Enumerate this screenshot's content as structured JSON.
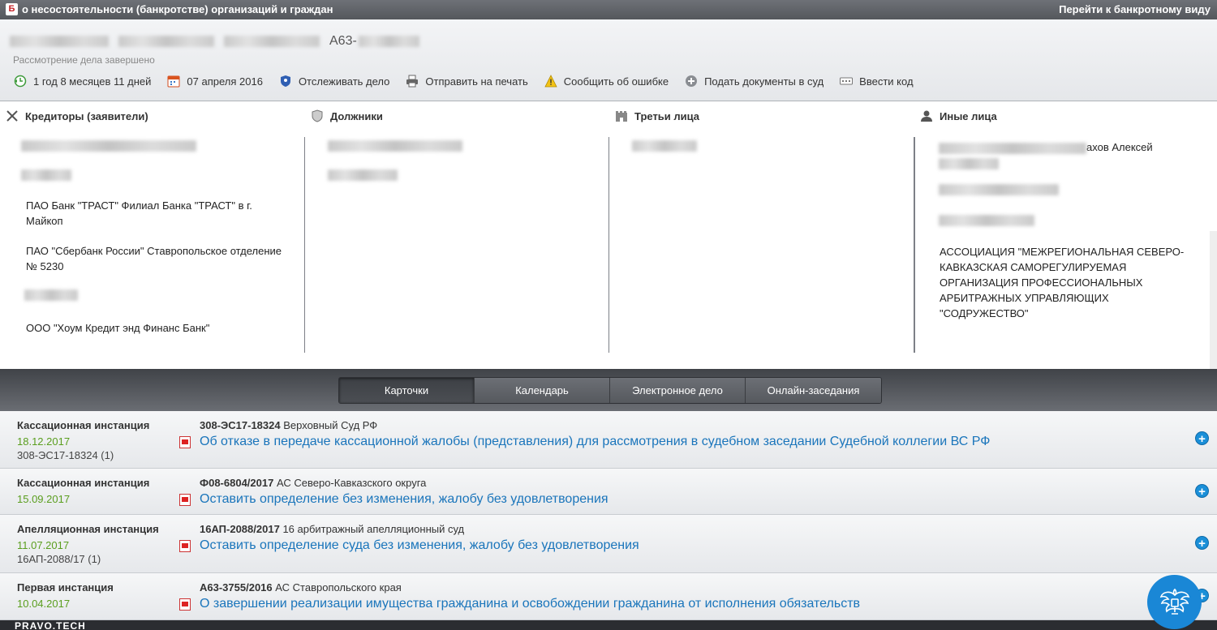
{
  "topbar": {
    "logo": "Б",
    "title": "о несостоятельности (банкротстве) организаций и граждан",
    "switch_view": "Перейти к банкротному виду"
  },
  "case": {
    "number_prefix": "А63-",
    "status": "Рассмотрение дела завершено",
    "actions": [
      {
        "label": "1 год 8 месяцев 11 дней",
        "icon": "duration-icon"
      },
      {
        "label": "07 апреля 2016",
        "icon": "calendar-icon"
      },
      {
        "label": "Отслеживать дело",
        "icon": "shield-icon"
      },
      {
        "label": "Отправить на печать",
        "icon": "printer-icon"
      },
      {
        "label": "Сообщить об ошибке",
        "icon": "warning-icon"
      },
      {
        "label": "Подать документы в суд",
        "icon": "plus-circle-icon"
      },
      {
        "label": "Ввести код",
        "icon": "keyboard-icon"
      }
    ]
  },
  "parties": {
    "creditors": {
      "heading": "Кредиторы (заявители)",
      "entries": [
        "ПАО Банк \"ТРАСТ\" Филиал Банка \"ТРАСТ\" в г. Майкоп",
        "ПАО \"Сбербанк России\" Ставропольское отделение № 5230",
        "ООО \"Хоум Кредит энд Финанс Банк\""
      ]
    },
    "debtors": {
      "heading": "Должники"
    },
    "third": {
      "heading": "Третьи лица"
    },
    "others": {
      "heading": "Иные лица",
      "first_suffix": "ахов Алексей",
      "association": "АССОЦИАЦИЯ \"МЕЖРЕГИОНАЛЬНАЯ СЕВЕРО-КАВКАЗСКАЯ САМОРЕГУЛИРУЕМАЯ ОРГАНИЗАЦИЯ ПРОФЕССИОНАЛЬНЫХ АРБИТРАЖНЫХ УПРАВЛЯЮЩИХ \"СОДРУЖЕСТВО\""
    }
  },
  "tabs": [
    "Карточки",
    "Календарь",
    "Электронное дело",
    "Онлайн-заседания"
  ],
  "instances": [
    {
      "instance": "Кассационная инстанция",
      "date": "18.12.2017",
      "sub": "308-ЭС17-18324 (1)",
      "case_no": "308-ЭС17-18324",
      "court": "Верховный Суд РФ",
      "document": "Об отказе в передаче кассационной жалобы (представления) для рассмотрения в судебном заседании Судебной коллегии ВС РФ"
    },
    {
      "instance": "Кассационная инстанция",
      "date": "15.09.2017",
      "sub": "",
      "case_no": "Ф08-6804/2017",
      "court": "АС Северо-Кавказского округа",
      "document": "Оставить определение без изменения, жалобу без удовлетворения"
    },
    {
      "instance": "Апелляционная инстанция",
      "date": "11.07.2017",
      "sub": "16АП-2088/17 (1)",
      "case_no": "16АП-2088/2017",
      "court": "16 арбитражный апелляционный суд",
      "document": "Оставить определение суда без изменения, жалобу без удовлетворения"
    },
    {
      "instance": "Первая инстанция",
      "date": "10.04.2017",
      "sub": "",
      "case_no": "А63-3755/2016",
      "court": "АС Ставропольского края",
      "document": "О завершении реализации имущества гражданина и освобождении гражданина от исполнения обязательств"
    }
  ],
  "footer": {
    "brand": "PRAVO.TECH"
  }
}
